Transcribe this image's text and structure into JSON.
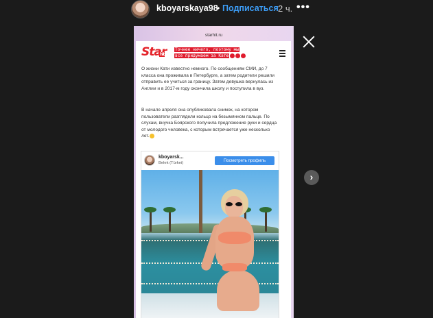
{
  "header": {
    "username": "kboyarskaya98",
    "separator": "•",
    "follow_label": "Подписаться",
    "time_ago": "2 ч.",
    "more_glyph": "•••"
  },
  "story": {
    "progress_fraction": 0.82,
    "source_url": "starhit.ru",
    "next_glyph": "›"
  },
  "article": {
    "logo_text": "Star",
    "logo_sub": "hit",
    "highlight_lines": [
      "Точнее ничего, поэтому мы",
      "все придумаем за Катю"
    ],
    "paragraph1": "О жизни Кати известно немного. По сообщениям СМИ, до 7 класса она проживала в Петербурге, а затем родители решили отправить ее учиться за границу. Затем девушка вернулась из Англии и в 2017-м году окончила школу и поступила в вуз.",
    "paragraph2": "В начале апреля она опубликовала снимок, на котором пользователи разглядели кольцо на безымянном пальце. По слухам, внучка Боярского получила предложение руки и сердца от молодого человека, с которым встречается уже несколько лет.",
    "embed": {
      "username": "kboyarsk...",
      "location": "Belek (Türkei)",
      "button_label": "Посмотреть профиль"
    }
  },
  "colors": {
    "accent_link": "#3d9df6",
    "highlight_red": "#e01b2d",
    "logo_red": "#e4232a",
    "ig_button": "#3b8eea"
  },
  "icons": [
    "avatar",
    "more-icon",
    "close-icon",
    "next-arrow-icon",
    "menu-icon",
    "emoji-icon"
  ]
}
